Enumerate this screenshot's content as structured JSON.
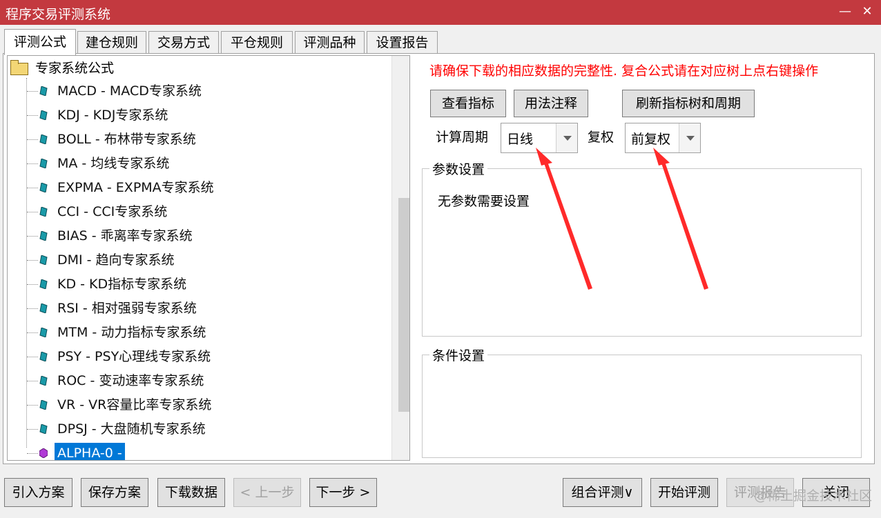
{
  "window": {
    "title": "程序交易评测系统",
    "controls": [
      "—",
      "✕"
    ]
  },
  "tabs": [
    {
      "label": "评测公式",
      "active": true
    },
    {
      "label": "建仓规则"
    },
    {
      "label": "交易方式"
    },
    {
      "label": "平仓规则"
    },
    {
      "label": "评测品种"
    },
    {
      "label": "设置报告"
    }
  ],
  "tree": {
    "root": "专家系统公式",
    "items": [
      "MACD - MACD专家系统",
      "KDJ - KDJ专家系统",
      "BOLL - 布林带专家系统",
      "MA - 均线专家系统",
      "EXPMA - EXPMA专家系统",
      "CCI - CCI专家系统",
      "BIAS - 乖离率专家系统",
      "DMI - 趋向专家系统",
      "KD - KD指标专家系统",
      "RSI - 相对强弱专家系统",
      "MTM - 动力指标专家系统",
      "PSY - PSY心理线专家系统",
      "ROC - 变动速率专家系统",
      "VR - VR容量比率专家系统",
      "DPSJ - 大盘随机专家系统",
      "ALPHA-0 -"
    ],
    "selected_index": 15
  },
  "right": {
    "notice": "请确保下载的相应数据的完整性. 复合公式请在对应树上点右键操作",
    "view_indicator_button": "查看指标",
    "usage_notes_button": "用法注释",
    "refresh_button": "刷新指标树和周期",
    "period_label": "计算周期",
    "period_value": "日线",
    "adjust_label": "复权",
    "adjust_value": "前复权",
    "params_group": "参数设置",
    "params_text": "无参数需要设置",
    "conditions_group": "条件设置"
  },
  "bottom": {
    "import_plan": "引入方案",
    "save_plan": "保存方案",
    "download_data": "下载数据",
    "prev_step": "< 上一步",
    "next_step": "下一步 >",
    "combo_test": "组合评测∨",
    "start_test": "开始评测",
    "test_report": "评测报告",
    "close": "关闭"
  },
  "watermark": "@稀土掘金技术社区",
  "colors": {
    "titlebar": "#c3393f",
    "notice": "#ff0000",
    "selection": "#0078d7",
    "annotation_arrow": "#ff2a2a"
  }
}
